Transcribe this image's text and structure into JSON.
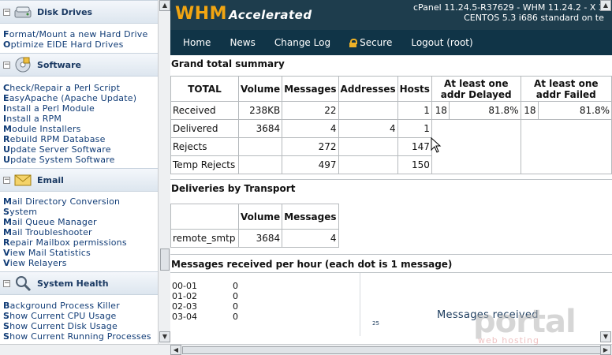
{
  "sidebar": {
    "sections": [
      {
        "title": "Disk Drives",
        "icon": "disk-drive-icon",
        "links": [
          {
            "first": "F",
            "rest": "ormat/Mount a new Hard Drive"
          },
          {
            "first": "O",
            "rest": "ptimize EIDE Hard Drives"
          }
        ]
      },
      {
        "title": "Software",
        "icon": "software-cd-icon",
        "links": [
          {
            "first": "C",
            "rest": "heck/Repair a Perl Script"
          },
          {
            "first": "E",
            "rest": "asyApache (Apache Update)"
          },
          {
            "first": "I",
            "rest": "nstall a Perl Module"
          },
          {
            "first": "I",
            "rest": "nstall a RPM"
          },
          {
            "first": "M",
            "rest": "odule Installers"
          },
          {
            "first": "R",
            "rest": "ebuild RPM Database"
          },
          {
            "first": "U",
            "rest": "pdate Server Software"
          },
          {
            "first": "U",
            "rest": "pdate System Software"
          }
        ]
      },
      {
        "title": "Email",
        "icon": "email-envelope-icon",
        "links": [
          {
            "first": "M",
            "rest": "ail Directory Conversion"
          },
          {
            "first": "S",
            "rest": "ystem"
          },
          {
            "first": "M",
            "rest": "ail Queue Manager"
          },
          {
            "first": "M",
            "rest": "ail Troubleshooter"
          },
          {
            "first": "R",
            "rest": "epair Mailbox permissions"
          },
          {
            "first": "V",
            "rest": "iew Mail Statistics"
          },
          {
            "first": "V",
            "rest": "iew Relayers"
          }
        ]
      },
      {
        "title": "System Health",
        "icon": "magnifier-icon",
        "links": [
          {
            "first": "B",
            "rest": "ackground Process Killer"
          },
          {
            "first": "S",
            "rest": "how Current CPU Usage"
          },
          {
            "first": "S",
            "rest": "how Current Disk Usage"
          },
          {
            "first": "S",
            "rest": "how Current Running Processes"
          }
        ]
      }
    ],
    "toggle_symbol": "⊟"
  },
  "header": {
    "logo_main": "WHM",
    "logo_accent": "Accelerated",
    "version_line1": "cPanel 11.24.5-R37629 - WHM 11.24.2 - X 3",
    "version_line2": "CENTOS 5.3 i686 standard on te"
  },
  "nav": [
    "Home",
    "News",
    "Change Log",
    "Secure",
    "Logout (root)"
  ],
  "grand_total": {
    "title": "Grand total summary",
    "headers": [
      "TOTAL",
      "Volume",
      "Messages",
      "Addresses",
      "Hosts",
      "At least one addr Delayed",
      "At least one addr Failed"
    ],
    "rows": [
      {
        "label": "Received",
        "volume": "238KB",
        "messages": "22",
        "addresses": "",
        "hosts": "1",
        "delayed_n": "18",
        "delayed_pct": "81.8%",
        "failed_n": "18",
        "failed_pct": "81.8%"
      },
      {
        "label": "Delivered",
        "volume": "3684",
        "messages": "4",
        "addresses": "4",
        "hosts": "1"
      },
      {
        "label": "Rejects",
        "volume": "",
        "messages": "272",
        "addresses": "",
        "hosts": "147"
      },
      {
        "label": "Temp Rejects",
        "volume": "",
        "messages": "497",
        "addresses": "",
        "hosts": "150"
      }
    ]
  },
  "transport": {
    "title": "Deliveries by Transport",
    "headers": [
      "",
      "Volume",
      "Messages"
    ],
    "rows": [
      {
        "label": "remote_smtp",
        "volume": "3684",
        "messages": "4"
      }
    ]
  },
  "hourly": {
    "title": "Messages received per hour (each dot is 1 message)",
    "rows": [
      {
        "hour": "00-01",
        "count": "0"
      },
      {
        "hour": "01-02",
        "count": "0"
      },
      {
        "hour": "02-03",
        "count": "0"
      },
      {
        "hour": "03-04",
        "count": "0"
      }
    ],
    "graph_title": "Messages received",
    "graph_tick": "25"
  },
  "watermark": {
    "main": "portal",
    "sub": "web hosting"
  },
  "colors": {
    "topbar": "#1e3d4d",
    "navbar": "#103447",
    "logo": "#f1a512",
    "link": "#123d77"
  }
}
